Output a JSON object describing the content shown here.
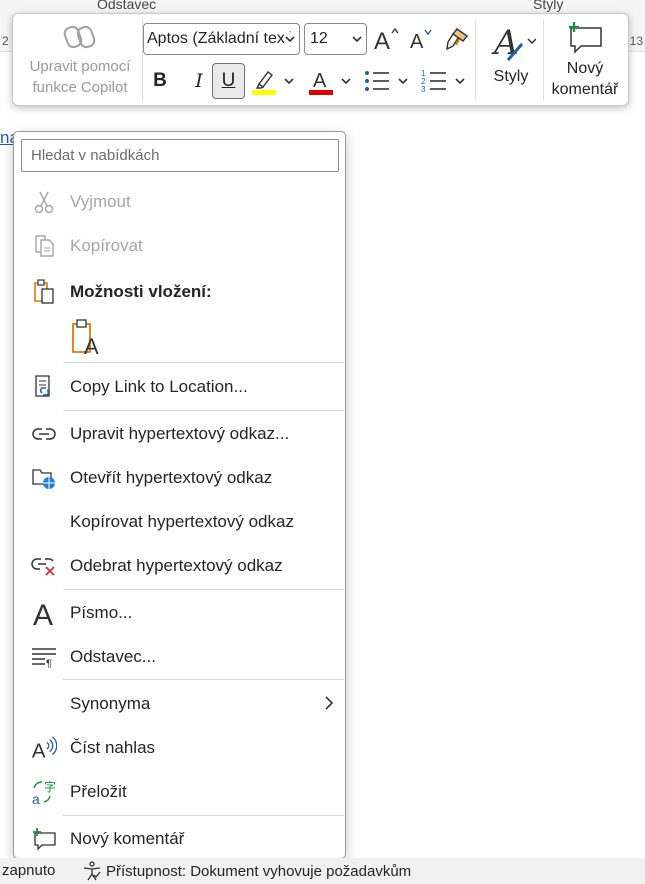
{
  "ribbon": {
    "group_paragraph": "Odstavec",
    "group_styles": "Styly",
    "ruler_left": "2",
    "ruler_right": "13"
  },
  "doc": {
    "fragment": "na"
  },
  "mini_toolbar": {
    "copilot_label": "Upravit pomocí funkce Copilot",
    "font_name": "Aptos (Základní text)",
    "font_size": "12",
    "styles_label": "Styly",
    "new_comment_label": "Nový komentář",
    "highlight_color": "#ffff00",
    "font_color": "#e00000"
  },
  "context_menu": {
    "search_placeholder": "Hledat v nabídkách",
    "items": [
      {
        "label": "Vyjmout",
        "icon": "scissors-icon",
        "disabled": true
      },
      {
        "label": "Kopírovat",
        "icon": "copy-icon",
        "disabled": true
      },
      {
        "label": "Možnosti vložení:",
        "icon": "paste-icon"
      },
      {
        "label": "",
        "icon": "paste-text-only-icon"
      },
      {
        "label": "Copy Link to Location...",
        "icon": "copy-link-icon"
      },
      {
        "label": "Upravit hypertextový odkaz...",
        "icon": "link-icon"
      },
      {
        "label": "Otevřít hypertextový odkaz",
        "icon": "open-link-icon"
      },
      {
        "label": "Kopírovat hypertextový odkaz",
        "icon": ""
      },
      {
        "label": "Odebrat hypertextový odkaz",
        "icon": "remove-link-icon"
      },
      {
        "label": "Písmo...",
        "icon": "font-icon"
      },
      {
        "label": "Odstavec...",
        "icon": "paragraph-icon"
      },
      {
        "label": "Synonyma",
        "icon": ""
      },
      {
        "label": "Číst nahlas",
        "icon": "read-aloud-icon"
      },
      {
        "label": "Přeložit",
        "icon": "translate-icon"
      },
      {
        "label": "Nový komentář",
        "icon": "new-comment-icon"
      }
    ]
  },
  "status_bar": {
    "left_text": "zapnuto",
    "accessibility_text": "Přístupnost: Dokument vyhovuje požadavkům"
  }
}
